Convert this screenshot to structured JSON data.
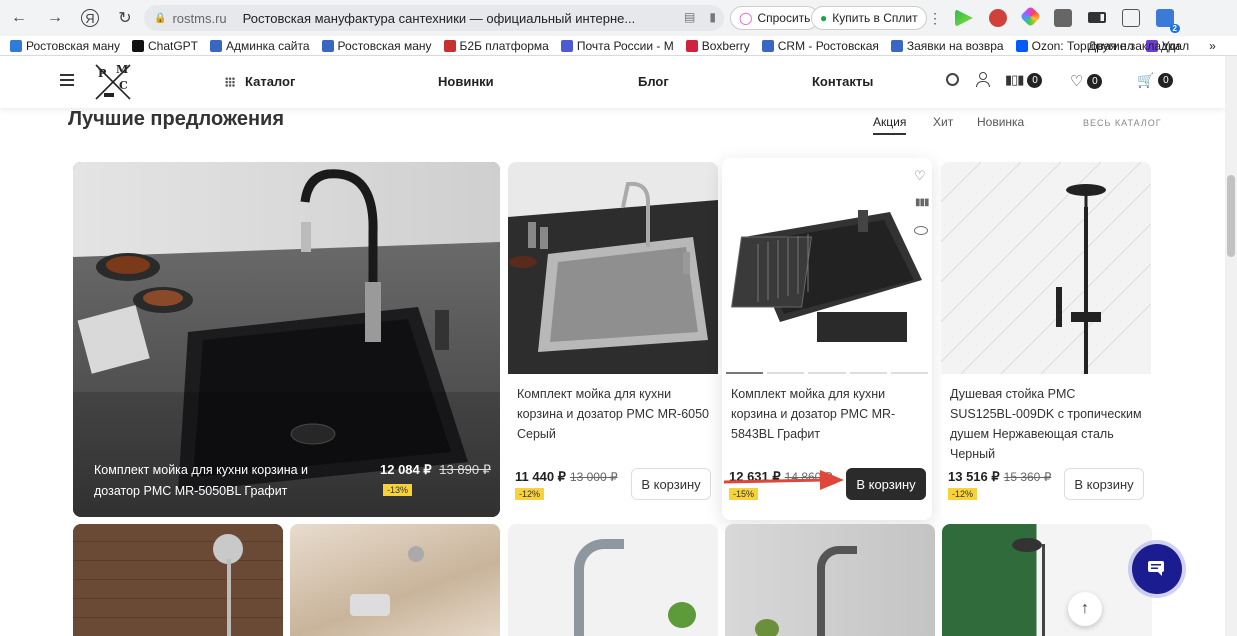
{
  "browser": {
    "host": "rostms.ru",
    "tab_title": "Ростовская мануфактура сантехники — официальный интерне...",
    "ask_label": "Спросить",
    "split_label": "Купить в Сплит",
    "ext_badge": "2"
  },
  "bookmarks": [
    {
      "label": "Ростовская ману",
      "icon": "cloud-icon",
      "color": "#2f7bd8"
    },
    {
      "label": "ChatGPT",
      "icon": "chatgpt-icon",
      "color": "#111111"
    },
    {
      "label": "Админка сайта",
      "icon": "star-grid-icon",
      "color": "#3a66c4"
    },
    {
      "label": "Ростовская ману",
      "icon": "star-grid-icon",
      "color": "#3a66c4"
    },
    {
      "label": "Б2Б платформа",
      "icon": "b2b-icon",
      "color": "#c92f2f"
    },
    {
      "label": "Почта России - М",
      "icon": "post-icon",
      "color": "#4a5bd4"
    },
    {
      "label": "Boxberry",
      "icon": "boxberry-icon",
      "color": "#d0213f"
    },
    {
      "label": "CRM - Ростовская",
      "icon": "star-grid-icon",
      "color": "#3a66c4"
    },
    {
      "label": "Заявки на возвра",
      "icon": "star-grid-icon",
      "color": "#3a66c4"
    },
    {
      "label": "Ozon: Торговая пл",
      "icon": "ozon-icon",
      "color": "#005bff"
    },
    {
      "label": "Удал",
      "icon": "remote-icon",
      "color": "#6b3fd4"
    }
  ],
  "bookmarks_more": "»",
  "other_bookmarks": "Другие закладки",
  "header": {
    "logo_letters": [
      "P",
      "M",
      "C"
    ],
    "menu": [
      {
        "label": "Каталог"
      },
      {
        "label": "Новинки"
      },
      {
        "label": "Блог"
      },
      {
        "label": "Контакты"
      }
    ],
    "compare_count": "0",
    "favorites_count": "0",
    "cart_count": "0"
  },
  "section": {
    "title": "Лучшие предложения",
    "tabs": [
      "Акция",
      "Хит",
      "Новинка"
    ],
    "active_tab": "Акция",
    "all_catalog": "ВЕСЬ КАТАЛОГ"
  },
  "featured": {
    "name": "Комплект мойка для кухни корзина и дозатор PMC MR-5050BL Графит",
    "price": "12 084 ₽",
    "old_price": "13 890 ₽",
    "discount": "-13%"
  },
  "products": [
    {
      "name": "Комплект мойка для кухни корзина и дозатор PMC MR-6050 Серый",
      "price": "11 440 ₽",
      "old_price": "13 000 ₽",
      "discount": "-12%",
      "cart_label": "В корзину"
    },
    {
      "name": "Комплект мойка для кухни корзина и дозатор PMC MR-5843BL Графит",
      "price": "12 631 ₽",
      "old_price": "14 860 ₽",
      "discount": "-15%",
      "cart_label": "В корзину"
    },
    {
      "name": "Душевая стойка PMC SUS125BL-009DK с тропическим душем Нержавеющая сталь Черный",
      "price": "13 516 ₽",
      "old_price": "15 360 ₽",
      "discount": "-12%",
      "cart_label": "В корзину"
    }
  ],
  "colors": {
    "accent_dark": "#2b2b2b",
    "discount_yellow": "#f8d23a",
    "chat_blue": "#1a1c8f",
    "arrow_red": "#e0473a"
  }
}
